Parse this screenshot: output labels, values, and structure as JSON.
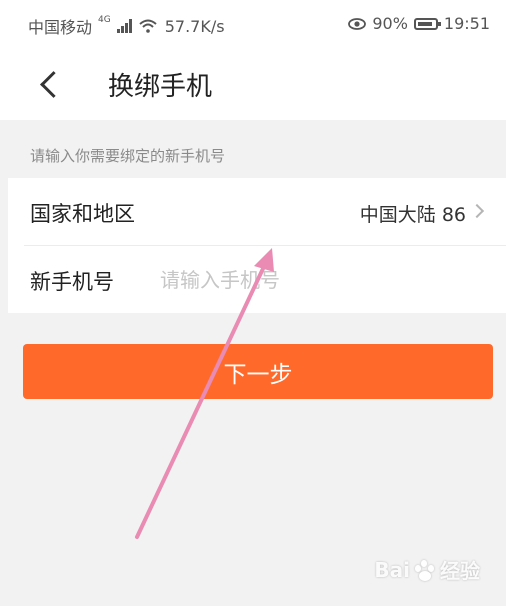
{
  "status_bar": {
    "carrier": "中国移动",
    "network_badge": "4G",
    "speed": "57.7K/s",
    "battery": "90%",
    "time": "19:51"
  },
  "nav": {
    "title": "换绑手机"
  },
  "form": {
    "hint": "请输入你需要绑定的新手机号",
    "region_label": "国家和地区",
    "region_value": "中国大陆 86",
    "phone_label": "新手机号",
    "phone_placeholder": "请输入手机号",
    "phone_value": ""
  },
  "actions": {
    "next_label": "下一步"
  },
  "watermark": {
    "brand_left": "Bai",
    "brand_right": "经验"
  },
  "colors": {
    "accent": "#ff6a2a",
    "arrow": "#e98bb3"
  }
}
